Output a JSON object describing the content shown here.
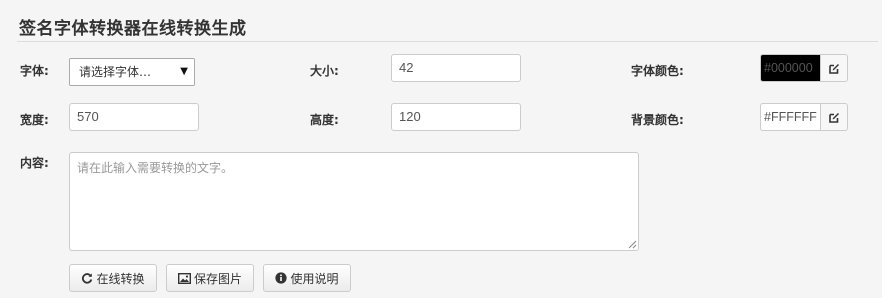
{
  "page": {
    "title": "签名字体转换器在线转换生成"
  },
  "form": {
    "font_label": "字体:",
    "font_select_value": "请选择字体…",
    "size_label": "大小:",
    "size_value": "42",
    "font_color_label": "字体颜色:",
    "font_color_value": "#000000",
    "width_label": "宽度:",
    "width_value": "570",
    "height_label": "高度:",
    "height_value": "120",
    "bg_color_label": "背景颜色:",
    "bg_color_value": "#FFFFFF",
    "content_label": "内容:",
    "content_placeholder": "请在此输入需要转换的文字。"
  },
  "buttons": {
    "convert_label": "在线转换",
    "save_label": "保存图片",
    "help_label": "使用说明"
  },
  "colors": {
    "font_color_swatch": "#000000",
    "font_color_text": "#555555",
    "bg_color_swatch": "#FFFFFF"
  },
  "icons": {
    "picker": "edit-icon",
    "convert": "refresh-icon",
    "save": "image-icon",
    "help": "info-icon"
  }
}
